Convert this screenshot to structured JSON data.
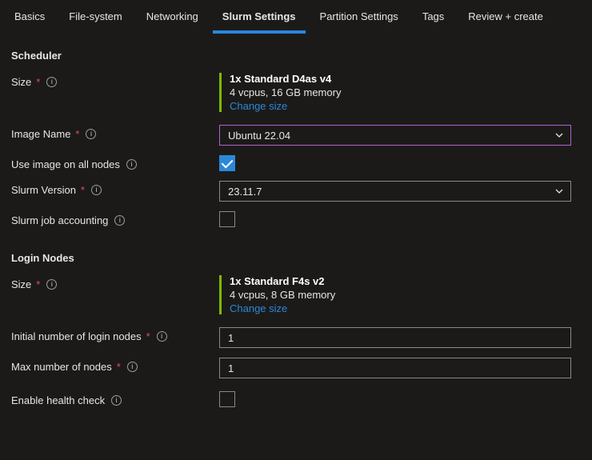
{
  "tabs": {
    "basics": "Basics",
    "filesystem": "File-system",
    "networking": "Networking",
    "slurm": "Slurm Settings",
    "partition": "Partition Settings",
    "tags": "Tags",
    "review": "Review + create"
  },
  "sections": {
    "scheduler": "Scheduler",
    "login_nodes": "Login Nodes"
  },
  "labels": {
    "size": "Size",
    "image_name": "Image Name",
    "use_image_all": "Use image on all nodes",
    "slurm_version": "Slurm Version",
    "slurm_accounting": "Slurm job accounting",
    "initial_login_nodes": "Initial number of login nodes",
    "max_nodes": "Max number of nodes",
    "enable_health": "Enable health check"
  },
  "scheduler_size": {
    "title": "1x Standard D4as v4",
    "sub": "4 vcpus, 16 GB memory",
    "link": "Change size"
  },
  "login_size": {
    "title": "1x Standard F4s v2",
    "sub": "4 vcpus, 8 GB memory",
    "link": "Change size"
  },
  "values": {
    "image_name": "Ubuntu 22.04",
    "slurm_version": "23.11.7",
    "initial_login_nodes": "1",
    "max_nodes": "1"
  }
}
